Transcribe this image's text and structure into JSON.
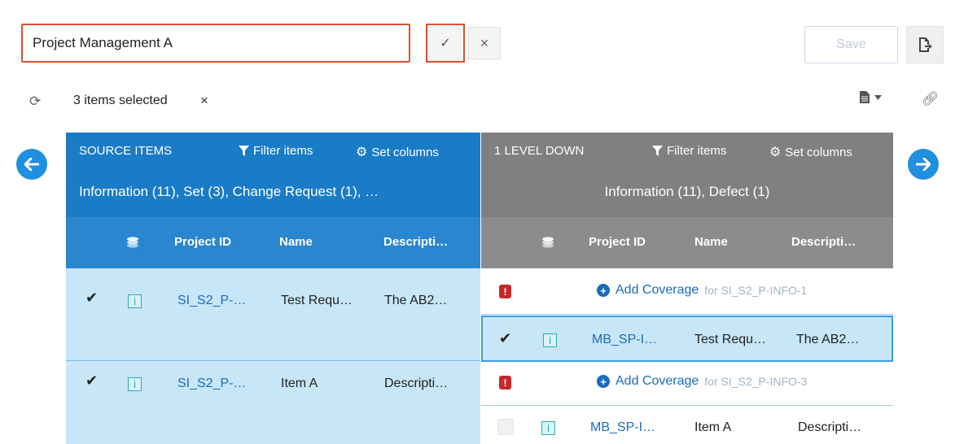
{
  "toolbar": {
    "name_value": "Project Management A",
    "confirm_icon": "✓",
    "cancel_icon": "×",
    "save_label": "Save"
  },
  "selection": {
    "label": "3 items selected",
    "clear_icon": "×"
  },
  "source_panel": {
    "title": "SOURCE ITEMS",
    "filter_label": "Filter items",
    "columns_label": "Set columns",
    "summary": "Information (11), Set (3), Change Request (1), …",
    "columns": [
      "Project ID",
      "Name",
      "Descripti…"
    ],
    "rows": [
      {
        "project_id": "SI_S2_P-…",
        "name": "Test Requ…",
        "description": "The AB2…"
      },
      {
        "project_id": "SI_S2_P-…",
        "name": "Item A",
        "description": "Descripti…"
      }
    ]
  },
  "level_panel": {
    "title": "1 LEVEL DOWN",
    "filter_label": "Filter items",
    "columns_label": "Set columns",
    "summary": "Information (11), Defect (1)",
    "columns": [
      "Project ID",
      "Name",
      "Descripti…"
    ],
    "add_coverage_label": "Add Coverage",
    "coverage_rows": [
      {
        "for_text": "for SI_S2_P-INFO-1"
      },
      {
        "for_text": "for SI_S2_P-INFO-3"
      }
    ],
    "rows": [
      {
        "project_id": "MB_SP-I…",
        "name": "Test Requ…",
        "description": "The AB2…"
      },
      {
        "project_id": "MB_SP-I…",
        "name": "Item A",
        "description": "Descripti…"
      }
    ]
  },
  "colors": {
    "source_header": "#1a7bc6",
    "level_header": "#808080",
    "selected_row": "#c7e6f7",
    "accent_border": "#d9532f"
  }
}
